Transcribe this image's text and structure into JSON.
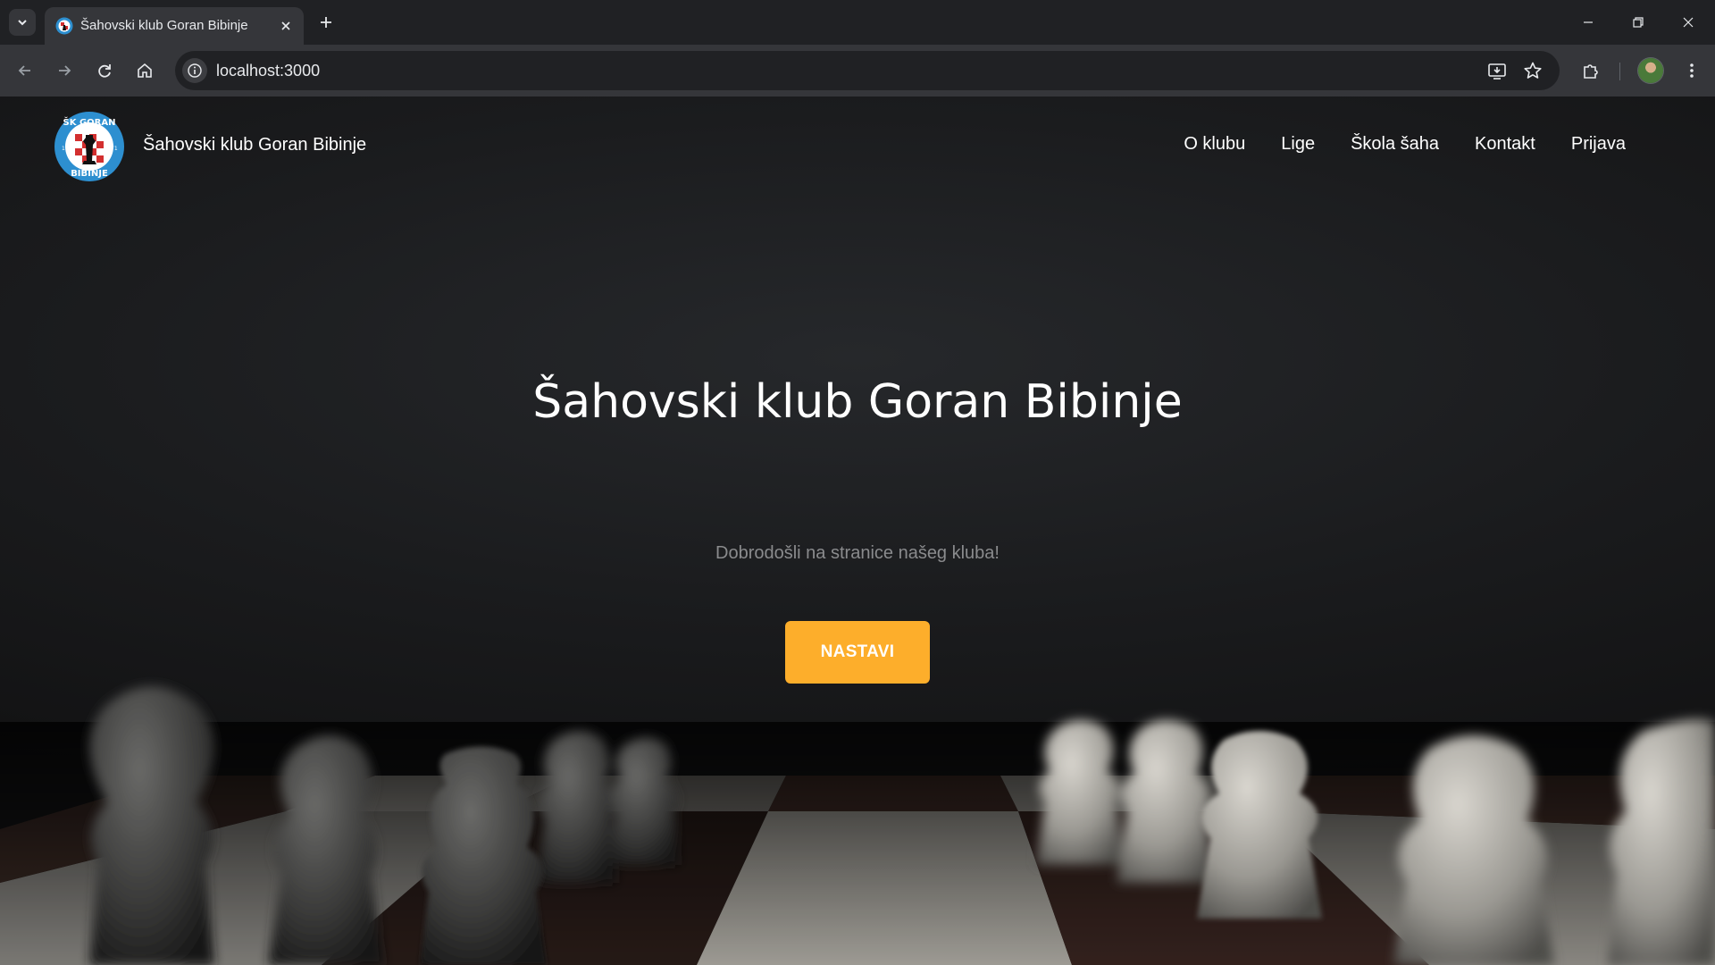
{
  "browser": {
    "tab_title": "Šahovski klub Goran Bibinje",
    "url": "localhost:3000"
  },
  "site": {
    "brand": "Šahovski klub Goran Bibinje",
    "logo_text_top": "ŠK GORAN",
    "logo_text_bottom": "BIBINJE",
    "logo_year_left": "19",
    "logo_year_right": "71",
    "nav": [
      "O klubu",
      "Lige",
      "Škola šaha",
      "Kontakt",
      "Prijava"
    ]
  },
  "hero": {
    "title": "Šahovski klub Goran Bibinje",
    "subtitle": "Dobrodošli na stranice našeg kluba!",
    "button": "NASTAVI"
  },
  "colors": {
    "accent": "#fdae2b",
    "chrome_dark": "#202124",
    "chrome_toolbar": "#35363a"
  }
}
